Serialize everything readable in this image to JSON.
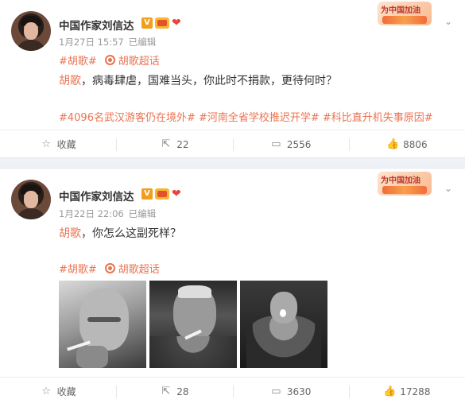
{
  "posts": [
    {
      "author": "中国作家刘信达",
      "time": "1月27日 15:57",
      "edited": "已编辑",
      "tag": "#胡歌#",
      "supertopic": "胡歌超话",
      "mention": "胡歌",
      "text": "，病毒肆虐，国难当头，你此时不捐款，更待何时？",
      "hashtags": "#4096名武汉游客仍在境外# #河南全省学校推迟开学# #科比直升机失事原因#",
      "promo": "为中国加油",
      "actions": {
        "collect": "收藏",
        "repost": "22",
        "comment": "2556",
        "like": "8806"
      }
    },
    {
      "author": "中国作家刘信达",
      "time": "1月22日 22:06",
      "edited": "已编辑",
      "tag": "#胡歌#",
      "supertopic": "胡歌超话",
      "mention": "胡歌",
      "text": "，你怎么这副死样？",
      "promo": "为中国加油",
      "actions": {
        "collect": "收藏",
        "repost": "28",
        "comment": "3630",
        "like": "17288"
      }
    }
  ],
  "icons": {
    "verified": "verified-v-icon",
    "member": "crown-member-icon",
    "heart": "red-heart-icon",
    "chevron": "chevron-down-icon",
    "collect": "star-icon",
    "repost": "share-icon",
    "comment": "comment-icon",
    "like": "thumbs-up-icon",
    "supertopic": "supertopic-ring-icon"
  },
  "colors": {
    "accent": "#eb7350",
    "text": "#333333",
    "meta": "#999999",
    "separator": "#eef1f6"
  }
}
